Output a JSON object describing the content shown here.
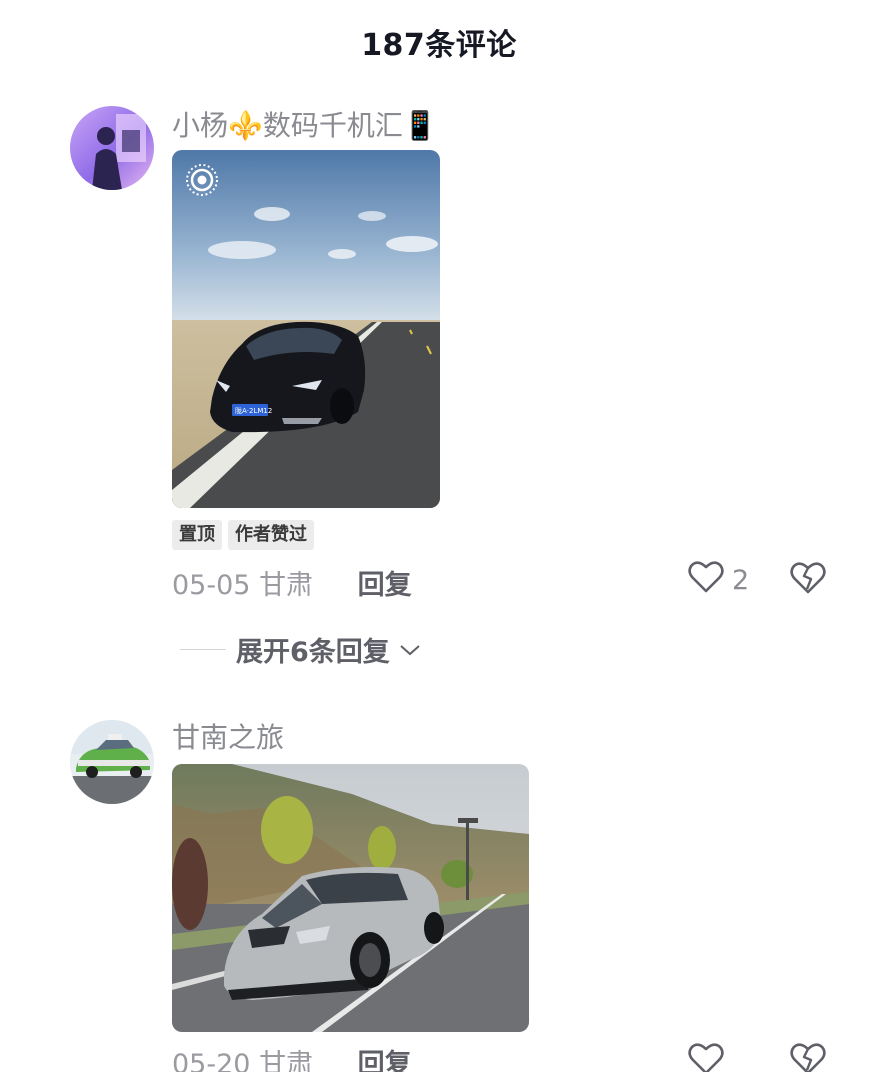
{
  "header": {
    "title": "187条评论"
  },
  "comments": [
    {
      "username": "小杨⚜️数码千机汇📱",
      "badges": [
        "置顶",
        "作者赞过"
      ],
      "date": "05-05",
      "location": "甘肃",
      "reply_label": "回复",
      "like_count": "2",
      "expand_label": "展开6条回复",
      "plate_text": "陇A·2LM12",
      "icons": {
        "like": "heart-outline-icon",
        "dislike": "broken-heart-icon",
        "live": "live-photo-icon",
        "expand": "chevron-down-icon"
      }
    },
    {
      "username": "甘南之旅",
      "date": "05-20",
      "location": "甘肃",
      "reply_label": "回复",
      "like_count": "",
      "icons": {
        "like": "heart-outline-icon",
        "dislike": "broken-heart-icon"
      }
    }
  ],
  "colors": {
    "title": "#161823",
    "secondary_text": "#8a8b91",
    "reply": "#5f6067",
    "badge_bg": "#ececec"
  }
}
